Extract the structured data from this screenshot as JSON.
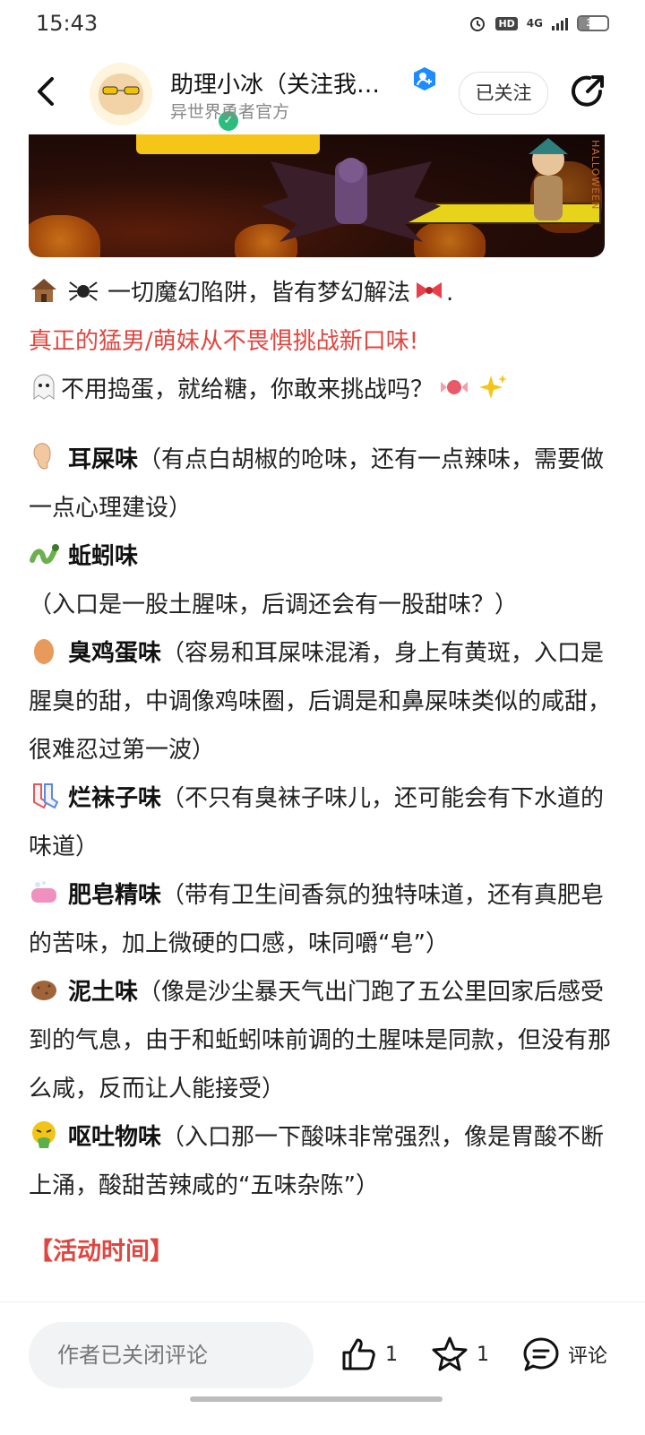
{
  "status": {
    "time": "15:43",
    "network": "4G",
    "hd": "HD",
    "battery": "37",
    "battery_level": 0.37
  },
  "header": {
    "title": "助理小冰（关注我…",
    "subtitle": "异世界勇者官方",
    "follow_label": "已关注",
    "icons": [
      "back-arrow-icon",
      "verified-check-icon",
      "account-badge-icon",
      "share-icon"
    ]
  },
  "banner": {
    "side_text": "HALLOWEEN"
  },
  "content": {
    "intro1": "一切魔幻陷阱，皆有梦幻解法",
    "intro1_end": ".",
    "intro2": "真正的猛男/萌妹从不畏惧挑战新口味!",
    "intro3": "不用捣蛋，就给糖，你敢来挑战吗？",
    "flavors": [
      {
        "icon": "ear-emoji",
        "name": "耳屎味",
        "desc": "（有点白胡椒的呛味，还有一点辣味，需要做一点心理建设）"
      },
      {
        "icon": "worm-emoji",
        "name": "蚯蚓味",
        "desc": "（入口是一股土腥味，后调还会有一股甜味？）"
      },
      {
        "icon": "egg-emoji",
        "name": "臭鸡蛋味",
        "desc": "（容易和耳屎味混淆，身上有黄斑，入口是腥臭的甜，中调像鸡味圈，后调是和鼻屎味类似的咸甜，很难忍过第一波）"
      },
      {
        "icon": "socks-emoji",
        "name": "烂袜子味",
        "desc": "（不只有臭袜子味儿，还可能会有下水道的味道）"
      },
      {
        "icon": "soap-emoji",
        "name": "肥皂精味",
        "desc": "（带有卫生间香氛的独特味道，还有真肥皂的苦味，加上微硬的口感，味同嚼“皂”）"
      },
      {
        "icon": "potato-emoji",
        "name": "泥土味",
        "desc": "（像是沙尘暴天气出门跑了五公里回家后感受到的气息，由于和蚯蚓味前调的土腥味是同款，但没有那么咸，反而让人能接受）"
      },
      {
        "icon": "vomit-emoji",
        "name": "呕吐物味",
        "desc": "（入口那一下酸味非常强烈，像是胃酸不断上涌，酸甜苦辣咸的“五味杂陈”）"
      }
    ],
    "section_title": "【活动时间】"
  },
  "bottom": {
    "comment_placeholder": "作者已关闭评论",
    "like_count": "1",
    "fav_count": "1",
    "comment_label": "评论"
  },
  "colors": {
    "accent_red": "#e0463f",
    "verified_green": "#2bbd7e",
    "badge_blue": "#1e8bff"
  }
}
